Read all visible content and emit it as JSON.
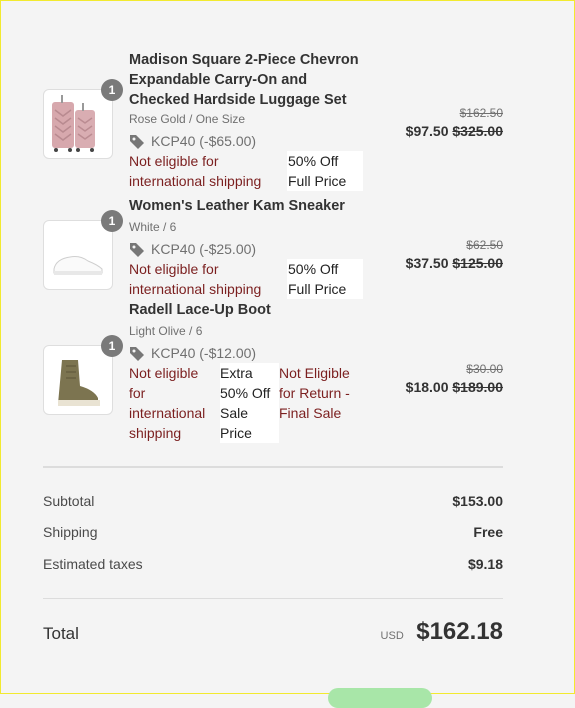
{
  "items": [
    {
      "qty": "1",
      "title_lines": [
        "Madison Square 2-Piece Chevron",
        "Expandable Carry-On and",
        "Checked Hardside Luggage Set"
      ],
      "variant": "Rose Gold / One Size",
      "discount": "KCP40 (-$65.00)",
      "red_lines": [
        "Not eligible for",
        "international shipping"
      ],
      "box_lines": [
        "50% Off",
        "Full Price"
      ],
      "old_price": "$162.50",
      "price": "$97.50",
      "compare_price": "$325.00"
    },
    {
      "qty": "1",
      "title_lines": [
        "Women's Leather Kam Sneaker"
      ],
      "variant": "White / 6",
      "discount": "KCP40 (-$25.00)",
      "red_lines": [
        "Not eligible for",
        "international shipping"
      ],
      "box_lines": [
        "50% Off",
        "Full Price"
      ],
      "old_price": "$62.50",
      "price": "$37.50",
      "compare_price": "$125.00"
    },
    {
      "qty": "1",
      "title_lines": [
        "Radell Lace-Up Boot"
      ],
      "variant": "Light Olive / 6",
      "discount": "KCP40 (-$12.00)",
      "red_lines": [
        "Not eligible",
        "for",
        "international",
        "shipping"
      ],
      "box_lines": [
        "Extra",
        "50% Off",
        "Sale",
        "Price"
      ],
      "return_lines": [
        "Not Eligible",
        "for Return -",
        "Final Sale"
      ],
      "old_price": "$30.00",
      "price": "$18.00",
      "compare_price": "$189.00"
    }
  ],
  "summary": {
    "subtotal_label": "Subtotal",
    "subtotal_value": "$153.00",
    "shipping_label": "Shipping",
    "shipping_value": "Free",
    "taxes_label": "Estimated taxes",
    "taxes_value": "$9.18",
    "total_label": "Total",
    "currency": "USD",
    "total_value": "$162.18"
  },
  "icons": {
    "discount": "tag-icon"
  },
  "colors": {
    "warning_text": "#7b1f1f",
    "badge": "#7a7a7a"
  }
}
